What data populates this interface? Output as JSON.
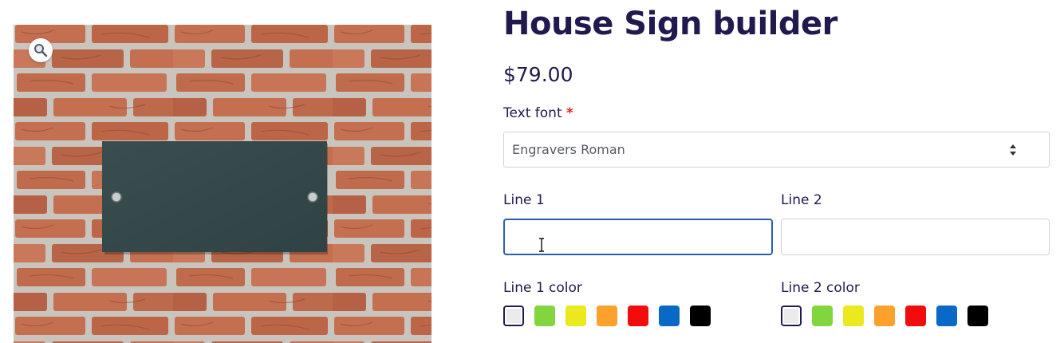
{
  "product": {
    "title": "House Sign builder",
    "price": "$79.00"
  },
  "gallery": {
    "zoom_icon": "magnifier-icon",
    "image": "slate-sign-on-brick-wall"
  },
  "text_font": {
    "label": "Text font",
    "required_mark": "*",
    "value": "Engravers Roman"
  },
  "line1": {
    "label": "Line 1",
    "value": ""
  },
  "line2": {
    "label": "Line 2",
    "value": ""
  },
  "line1_color": {
    "label": "Line 1 color",
    "selected": 0,
    "swatches": [
      "#ebebed",
      "#80d63c",
      "#ebe81d",
      "#fba12c",
      "#f20c0c",
      "#0a68c7",
      "#000000"
    ]
  },
  "line2_color": {
    "label": "Line 2 color",
    "selected": 0,
    "swatches": [
      "#ebebed",
      "#80d63c",
      "#ebe81d",
      "#fba12c",
      "#f20c0c",
      "#0a68c7",
      "#000000"
    ]
  },
  "colors": {
    "brick": "#c46f4f",
    "mortar": "#c9c4bd",
    "sign": "#34484a",
    "heading": "#221a4f",
    "focus_border": "#2a5fb0"
  }
}
